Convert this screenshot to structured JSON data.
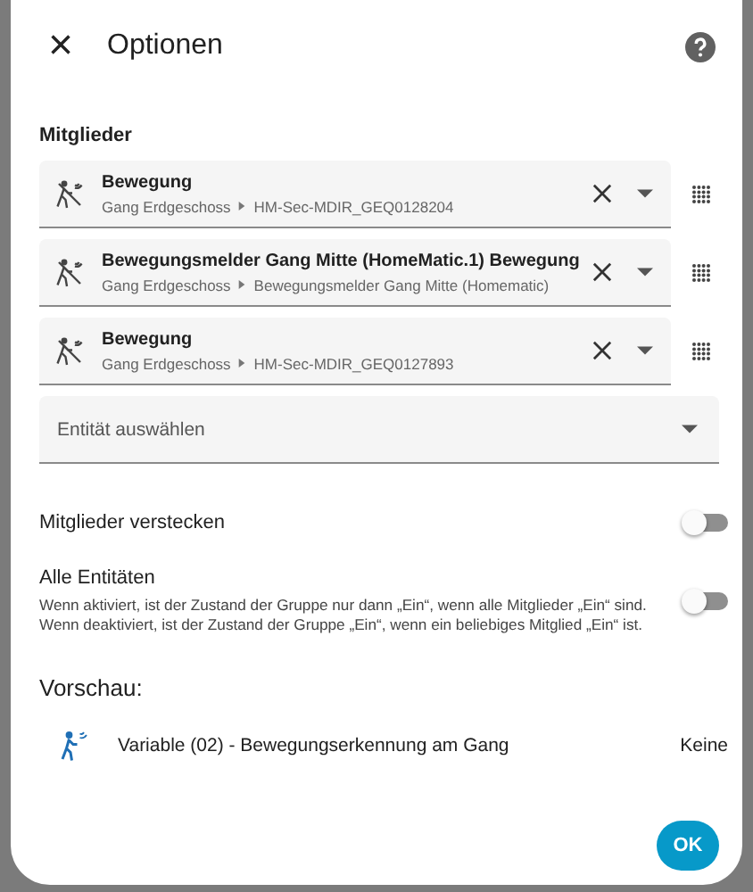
{
  "dialog": {
    "title": "Optionen",
    "close_icon": "×"
  },
  "members": {
    "heading": "Mitglieder",
    "items": [
      {
        "name": "Bewegung",
        "area": "Gang Erdgeschoss",
        "device": "HM-Sec-MDIR_GEQ0128204"
      },
      {
        "name": "Bewegungsmelder Gang Mitte (HomeMatic.1) Bewegung",
        "area": "Gang Erdgeschoss",
        "device": "Bewegungsmelder Gang Mitte (Homematic)"
      },
      {
        "name": "Bewegung",
        "area": "Gang Erdgeschoss",
        "device": "HM-Sec-MDIR_GEQ0127893"
      }
    ],
    "select_placeholder": "Entität auswählen"
  },
  "options": [
    {
      "label": "Mitglieder verstecken",
      "on": false
    },
    {
      "label": "Alle Entitäten",
      "description": "Wenn aktiviert, ist der Zustand der Gruppe nur dann „Ein“, wenn alle Mitglieder „Ein“ sind. Wenn deaktiviert, ist der Zustand der Gruppe „Ein“, wenn ein beliebiges Mitglied „Ein“ ist.",
      "on": false
    }
  ],
  "preview": {
    "heading": "Vorschau:",
    "name": "Variable (02) - Bewegungserkennung am Gang",
    "state": "Keine"
  },
  "buttons": [
    "OK"
  ]
}
